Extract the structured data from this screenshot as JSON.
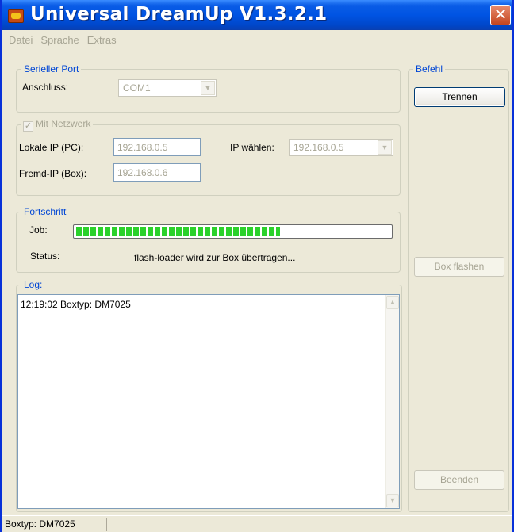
{
  "window": {
    "title": "Universal DreamUp V1.3.2.1",
    "close_glyph": "✕"
  },
  "menu": {
    "items": [
      "Datei",
      "Sprache",
      "Extras"
    ]
  },
  "serial_port": {
    "legend": "Serieller Port",
    "port_label": "Anschluss:",
    "port_value": "COM1"
  },
  "network": {
    "checkbox_label": "Mit Netzwerk",
    "checked": true,
    "local_ip_label": "Lokale IP (PC):",
    "local_ip_value": "192.168.0.5",
    "choose_ip_label": "IP wählen:",
    "choose_ip_value": "192.168.0.5",
    "remote_ip_label": "Fremd-IP (Box):",
    "remote_ip_value": "192.168.0.6"
  },
  "progress": {
    "legend": "Fortschritt",
    "job_label": "Job:",
    "job_fraction": 0.65,
    "status_label": "Status:",
    "status_text": "flash-loader wird zur Box übertragen..."
  },
  "log": {
    "legend": "Log:",
    "lines": [
      "12:19:02 Boxtyp: DM7025"
    ]
  },
  "command": {
    "legend": "Befehl",
    "disconnect_label": "Trennen",
    "flash_label": "Box flashen",
    "quit_label": "Beenden"
  },
  "statusbar": {
    "text": "Boxtyp: DM7025"
  },
  "colors": {
    "titlebar": "#0054e3",
    "window_bg": "#ece9d8",
    "legend_text": "#0046d5",
    "progress_fill": "#2bd12b",
    "disabled_text": "#a6a493"
  },
  "icons": {
    "app": "app-icon",
    "close": "close-icon",
    "dropdown": "chevron-down-icon",
    "scroll_up": "scroll-up-arrow-icon",
    "scroll_down": "scroll-down-arrow-icon"
  }
}
